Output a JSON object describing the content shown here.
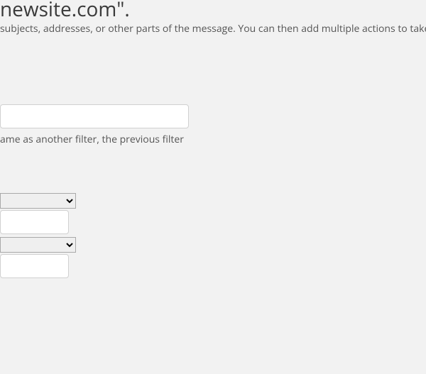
{
  "title_fragment": "newsite.com\".",
  "subtitle_fragment": "subjects, addresses, or other parts of the message. You can then add multiple actions to take",
  "filter_name": {
    "value": "",
    "hint_fragment": "ame as another filter, the previous filter"
  },
  "rules": {
    "select1": {
      "selected": "",
      "options": [
        ""
      ]
    },
    "input1": {
      "value": ""
    },
    "select2": {
      "selected": "",
      "options": [
        ""
      ]
    },
    "input2": {
      "value": ""
    }
  }
}
